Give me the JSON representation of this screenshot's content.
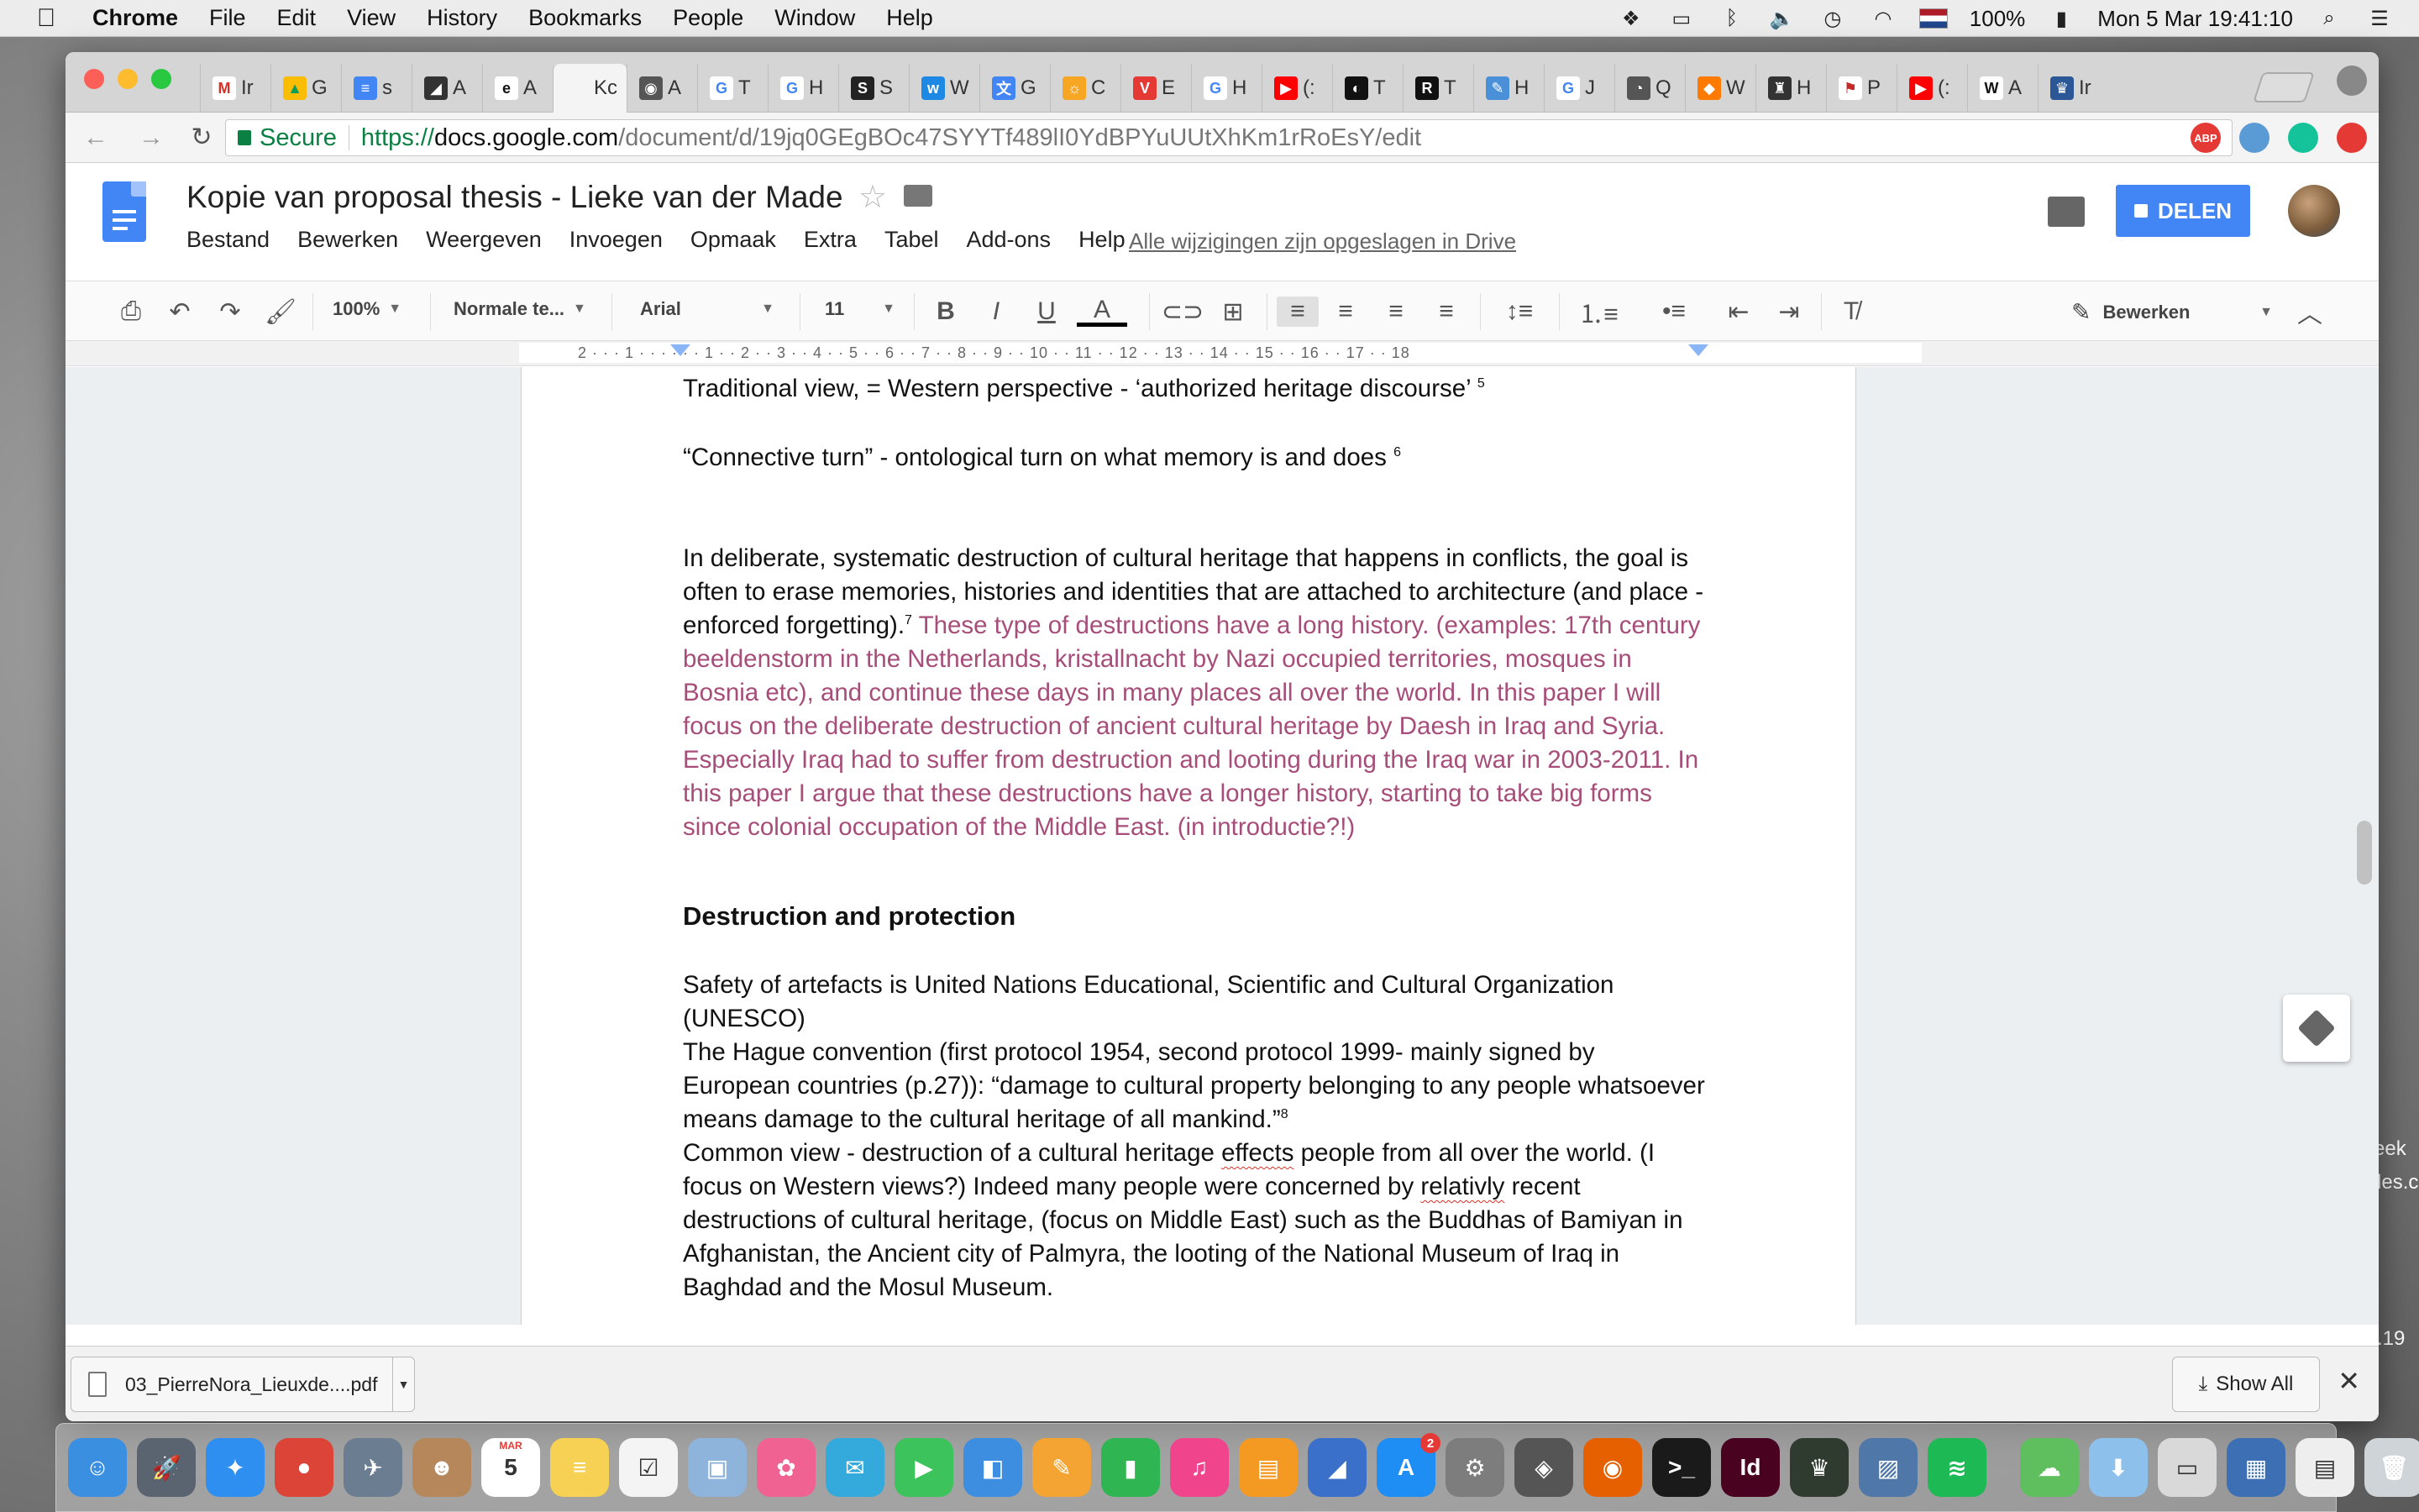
{
  "menubar": {
    "app": "Chrome",
    "items": [
      "File",
      "Edit",
      "View",
      "History",
      "Bookmarks",
      "People",
      "Window",
      "Help"
    ],
    "battery": "100%",
    "datetime": "Mon 5 Mar  19:41:10"
  },
  "browser": {
    "tabs": [
      {
        "label": "Ir",
        "icon": "gmail-icon",
        "color": "#ffffff",
        "glyph": "M",
        "fg": "#d93025"
      },
      {
        "label": "G",
        "icon": "drive-icon",
        "color": "#fbbc04",
        "glyph": "▲",
        "fg": "#0f9d58"
      },
      {
        "label": "s",
        "icon": "docs-icon",
        "color": "#4285f4",
        "glyph": "≡",
        "fg": "#ffffff"
      },
      {
        "label": "A",
        "icon": "artwork-icon",
        "color": "#333333",
        "glyph": "◢",
        "fg": "#ffffff"
      },
      {
        "label": "A",
        "icon": "e-logo-icon",
        "color": "#ffffff",
        "glyph": "e",
        "fg": "#111111"
      },
      {
        "label": "Kc",
        "icon": "docs-icon",
        "color": "transparent",
        "glyph": "",
        "fg": "#111111",
        "active": true
      },
      {
        "label": "A",
        "icon": "camera-icon",
        "color": "#555555",
        "glyph": "◉",
        "fg": "#ffffff"
      },
      {
        "label": "T",
        "icon": "google-icon",
        "color": "#ffffff",
        "glyph": "G",
        "fg": "#4285f4"
      },
      {
        "label": "H",
        "icon": "google-icon",
        "color": "#ffffff",
        "glyph": "G",
        "fg": "#4285f4"
      },
      {
        "label": "S",
        "icon": "s-logo-icon",
        "color": "#222222",
        "glyph": "S",
        "fg": "#ffffff"
      },
      {
        "label": "W",
        "icon": "w-logo-icon",
        "color": "#1e88e5",
        "glyph": "w",
        "fg": "#ffffff"
      },
      {
        "label": "G",
        "icon": "translate-icon",
        "color": "#4285f4",
        "glyph": "文",
        "fg": "#ffffff"
      },
      {
        "label": "C",
        "icon": "sun-icon",
        "color": "#f6a623",
        "glyph": "☼",
        "fg": "#ffffff"
      },
      {
        "label": "E",
        "icon": "red-shield-icon",
        "color": "#e53935",
        "glyph": "V",
        "fg": "#ffffff"
      },
      {
        "label": "H",
        "icon": "google-icon",
        "color": "#ffffff",
        "glyph": "G",
        "fg": "#4285f4"
      },
      {
        "label": "(:",
        "icon": "youtube-icon",
        "color": "#ff0000",
        "glyph": "▶",
        "fg": "#ffffff"
      },
      {
        "label": "T",
        "icon": "circle-logo-icon",
        "color": "#111111",
        "glyph": "◐",
        "fg": "#ffffff"
      },
      {
        "label": "T",
        "icon": "rtl-logo-icon",
        "color": "#111111",
        "glyph": "R",
        "fg": "#ffffff"
      },
      {
        "label": "H",
        "icon": "note-icon",
        "color": "#4a90d9",
        "glyph": "✎",
        "fg": "#ffffff"
      },
      {
        "label": "J",
        "icon": "google-icon",
        "color": "#ffffff",
        "glyph": "G",
        "fg": "#4285f4"
      },
      {
        "label": "Q",
        "icon": "lens-icon",
        "color": "#555555",
        "glyph": "◔",
        "fg": "#ffffff"
      },
      {
        "label": "W",
        "icon": "diamond-icon",
        "color": "#ff7a00",
        "glyph": "◆",
        "fg": "#ffffff"
      },
      {
        "label": "H",
        "icon": "crest-icon",
        "color": "#333333",
        "glyph": "♜",
        "fg": "#ffffff"
      },
      {
        "label": "P",
        "icon": "paper-icon",
        "color": "#ffffff",
        "glyph": "⚑",
        "fg": "#c62828"
      },
      {
        "label": "(:",
        "icon": "youtube-icon",
        "color": "#ff0000",
        "glyph": "▶",
        "fg": "#ffffff"
      },
      {
        "label": "A",
        "icon": "wikipedia-icon",
        "color": "#ffffff",
        "glyph": "W",
        "fg": "#111111"
      },
      {
        "label": "Ir",
        "icon": "crest-blue-icon",
        "color": "#2b5797",
        "glyph": "♛",
        "fg": "#ffffff"
      }
    ],
    "secure_label": "Secure",
    "url_scheme": "https://",
    "url_host": "docs.google.com",
    "url_path": "/document/d/19jq0GEgBOc47SYYTf489lI0YdBPYuUUtXhKm1rRoEsY/edit",
    "extensions": [
      {
        "icon": "adblock-icon",
        "label": "ABP",
        "color": "#e53935"
      },
      {
        "icon": "photo-ext-icon",
        "label": "",
        "color": "#5b9bd5"
      },
      {
        "icon": "grammarly-icon",
        "label": "",
        "color": "#15c39a"
      },
      {
        "icon": "upload-ext-icon",
        "label": "",
        "color": "#e53935"
      }
    ]
  },
  "docs": {
    "title": "Kopie van proposal thesis - Lieke van der Made",
    "menu": [
      "Bestand",
      "Bewerken",
      "Weergeven",
      "Invoegen",
      "Opmaak",
      "Extra",
      "Tabel",
      "Add-ons",
      "Help"
    ],
    "saved_status": "Alle wijzigingen zijn opgeslagen in Drive",
    "share_label": "DELEN",
    "toolbar": {
      "zoom": "100%",
      "style": "Normale te...",
      "font": "Arial",
      "size": "11",
      "mode": "Bewerken"
    },
    "ruler_text": "2 · · · 1 · · · · · · 1 · · 2 · · 3 · · 4 · · 5 · · 6 · · 7 · · 8 · · 9 · · 10 · · 11 · · 12 · · 13 · · 14 · · 15 · · 16 · · 17 · · 18",
    "ruler_numbers": [
      "2",
      "1",
      "1",
      "2",
      "3",
      "4",
      "5",
      "6",
      "7",
      "8",
      "9",
      "10",
      "11",
      "12",
      "13",
      "14",
      "15",
      "16",
      "17",
      "18"
    ],
    "content": {
      "line1": "Traditional view, = Western perspective - ‘authorized heritage discourse’",
      "line1_sup": "5",
      "line2": "“Connective turn” - ontological turn on what memory is and does",
      "line2_sup": "6",
      "para1_black": "In deliberate, systematic destruction of cultural heritage that happens in conflicts, the goal is often to erase memories, histories and identities that are attached to architecture (and place - enforced forgetting).",
      "para1_sup": "7",
      "para1_pink": " These type of destructions have a long history. (examples: 17th century beeldenstorm in the Netherlands, kristallnacht by Nazi occupied territories, mosques in Bosnia etc), and continue these days in many places all over the world. In this paper I will focus on the deliberate destruction of ancient cultural heritage by Daesh in Iraq and Syria. Especially Iraq had to suffer from destruction and looting during the Iraq war in 2003-2011. In this paper I argue that these destructions have a longer history, starting to take big forms since colonial occupation of the Middle East. (in introductie?!)",
      "heading": "Destruction and protection",
      "para2": "Safety of artefacts is United Nations Educational, Scientific and Cultural Organization (UNESCO)",
      "para3": "The Hague convention (first protocol 1954, second protocol 1999- mainly signed by European countries (p.27)): “damage to cultural property belonging to any people whatsoever means damage to the cultural heritage of all mankind.”",
      "para3_sup": "8",
      "para4_a": "Common view - destruction of a cultural heritage ",
      "para4_err1": "effects",
      "para4_b": " people from all over the world. (I focus on Western views?) Indeed many people were concerned by ",
      "para4_err2": "relativly",
      "para4_c": " recent destructions of cultural heritage, (focus on Middle East) such as the Buddhas of Bamiyan in Afghanistan, the Ancient city of Palmyra, the looting of the National Museum of Iraq in Baghdad and the Mosul Museum."
    }
  },
  "downloads": {
    "file": "03_PierreNora_Lieuxde....pdf",
    "show_all": "Show All"
  },
  "desktop_peek": {
    "text1": "eek",
    "text2": "des.c",
    "text3": ".19"
  },
  "dock": {
    "apps": [
      {
        "icon": "finder-icon",
        "color": "#3b8fe0",
        "glyph": "☺"
      },
      {
        "icon": "launchpad-icon",
        "color": "#5a6470",
        "glyph": "🚀"
      },
      {
        "icon": "safari-icon",
        "color": "#2f8ff0",
        "glyph": "✦"
      },
      {
        "icon": "chrome-icon",
        "color": "#db4437",
        "glyph": "●"
      },
      {
        "icon": "eagle-icon",
        "color": "#6b7d91",
        "glyph": "✈"
      },
      {
        "icon": "contacts-icon",
        "color": "#b5875a",
        "glyph": "☻"
      },
      {
        "icon": "calendar-icon",
        "color": "#ffffff",
        "glyph": "5"
      },
      {
        "icon": "notes-icon",
        "color": "#f7d154",
        "glyph": "≡"
      },
      {
        "icon": "reminders-icon",
        "color": "#f4f4f4",
        "glyph": "☑"
      },
      {
        "icon": "preview-icon",
        "color": "#8fb4dc",
        "glyph": "▣"
      },
      {
        "icon": "photos-icon",
        "color": "#f06292",
        "glyph": "✿"
      },
      {
        "icon": "messages-icon",
        "color": "#34aadc",
        "glyph": "✉"
      },
      {
        "icon": "facetime-icon",
        "color": "#3cc35b",
        "glyph": "▶"
      },
      {
        "icon": "keynote-icon",
        "color": "#3d8de0",
        "glyph": "◧"
      },
      {
        "icon": "pages-icon",
        "color": "#f4a432",
        "glyph": "✎"
      },
      {
        "icon": "numbers-icon",
        "color": "#2fb551",
        "glyph": "▮"
      },
      {
        "icon": "itunes-icon",
        "color": "#f0458c",
        "glyph": "♫"
      },
      {
        "icon": "ibooks-icon",
        "color": "#f49a23",
        "glyph": "▤"
      },
      {
        "icon": "keynote2-icon",
        "color": "#3a70c9",
        "glyph": "◢"
      },
      {
        "icon": "appstore-icon",
        "color": "#1e8ef5",
        "glyph": "A"
      },
      {
        "icon": "system-prefs-icon",
        "color": "#7d7d7d",
        "glyph": "⚙"
      },
      {
        "icon": "image-capture-icon",
        "color": "#555555",
        "glyph": "◈"
      },
      {
        "icon": "firefox-icon",
        "color": "#e66000",
        "glyph": "◉"
      },
      {
        "icon": "terminal-icon",
        "color": "#1a1a1a",
        "glyph": ">_"
      },
      {
        "icon": "indesign-icon",
        "color": "#49021f",
        "glyph": "Id"
      },
      {
        "icon": "trophy-icon",
        "color": "#2f3b2f",
        "glyph": "♛"
      },
      {
        "icon": "photo-icon",
        "color": "#4f78a8",
        "glyph": "▨"
      },
      {
        "icon": "spotify-icon",
        "color": "#1db954",
        "glyph": "≋"
      },
      {
        "icon": "cloud-icon",
        "color": "#5fbf5f",
        "glyph": "☁"
      },
      {
        "icon": "downloads-folder-icon",
        "color": "#8ec0ec",
        "glyph": "⬇"
      },
      {
        "icon": "window-icon",
        "color": "#d9d9d9",
        "glyph": "▭"
      },
      {
        "icon": "screen-icon",
        "color": "#3d6fb5",
        "glyph": "▦"
      },
      {
        "icon": "document-icon",
        "color": "#eeeeee",
        "glyph": "▤"
      },
      {
        "icon": "trash-icon",
        "color": "#cfd4d9",
        "glyph": "🗑"
      }
    ],
    "calendar_month": "MAR",
    "appstore_badge": "2"
  }
}
